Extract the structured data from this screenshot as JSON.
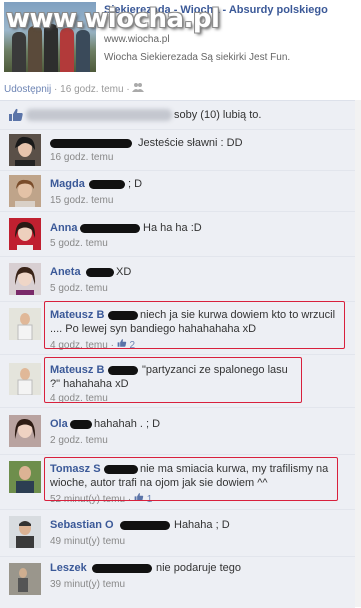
{
  "watermark": "www.wiocha.pl",
  "header": {
    "title": "Siekierezada - Wiocha - Absurdy polskiego",
    "url": "www.wiocha.pl",
    "description": "Wiocha Siekierezada Są siekirki Jest Fun."
  },
  "actions": {
    "share": "Udostępnij",
    "separator": "·",
    "time": "16 godz. temu",
    "separator2": "·"
  },
  "likes": {
    "text": "soby (10) lubią to."
  },
  "comments": [
    {
      "author": "",
      "text": "Jesteście sławni : DD",
      "time": "16 godz. temu",
      "likes": ""
    },
    {
      "author": "Magda",
      "text": "; D",
      "time": "15 godz. temu",
      "likes": ""
    },
    {
      "author": "Anna",
      "text": "Ha ha ha :D",
      "time": "5 godz. temu",
      "likes": ""
    },
    {
      "author": "Aneta",
      "text": "XD",
      "time": "5 godz. temu",
      "likes": ""
    },
    {
      "author": "Mateusz B",
      "text": "niech ja sie kurwa dowiem kto to wrzucil .... Po lewej syn bandiego hahahahaha xD",
      "time": "4 godz. temu",
      "likes": "2"
    },
    {
      "author": "Mateusz B",
      "text": "\"partyzanci ze spalonego lasu ?\" hahahaha xD",
      "time": "4 godz. temu",
      "likes": ""
    },
    {
      "author": "Ola",
      "text": "hahahah . ; D",
      "time": "2 godz. temu",
      "likes": ""
    },
    {
      "author": "Tomasz S",
      "text": "nie ma smiacia kurwa, my trafilismy na wioche, autor trafi na ojom jak sie dowiem ^^",
      "time": "52 minut(y) temu",
      "likes": "1"
    },
    {
      "author": "Sebastian O",
      "text": "Hahaha ; D",
      "time": "49 minut(y) temu",
      "likes": ""
    },
    {
      "author": "Leszek",
      "text": "nie podaruje tego",
      "time": "39 minut(y) temu",
      "likes": ""
    }
  ],
  "ui": {
    "dot": "·",
    "like_icon": "thumbs-up-icon",
    "accent": "#3b5998",
    "highlight": "#d8203c"
  }
}
